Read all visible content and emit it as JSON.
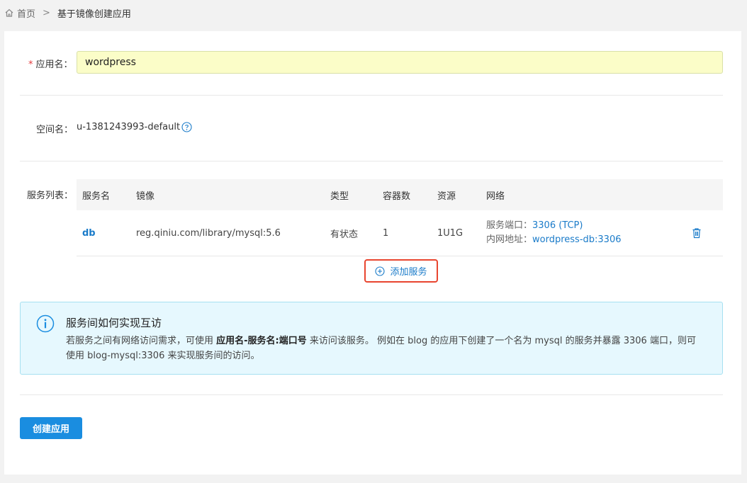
{
  "breadcrumb": {
    "home": "首页",
    "separator": ">",
    "current": "基于镜像创建应用"
  },
  "form": {
    "required_mark": "*",
    "app_name_label": "应用名：",
    "app_name_value": "wordpress",
    "namespace_label": "空间名：",
    "namespace_value": "u-1381243993-default",
    "services_label": "服务列表："
  },
  "table": {
    "headers": [
      "服务名",
      "镜像",
      "类型",
      "容器数",
      "资源",
      "网络"
    ],
    "rows": [
      {
        "name": "db",
        "image": "reg.qiniu.com/library/mysql:5.6",
        "type": "有状态",
        "containers": "1",
        "resource": "1U1G",
        "port_key": "服务端口：",
        "port_value": "3306 (TCP)",
        "addr_key": "内网地址：",
        "addr_value": "wordpress-db:3306"
      }
    ]
  },
  "add_service_label": "添加服务",
  "info": {
    "title": "服务间如何实现互访",
    "body_1": "若服务之间有网络访问需求，可使用 ",
    "body_bold": "应用名-服务名:端口号",
    "body_2": " 来访问该服务。 例如在 blog 的应用下创建了一个名为 mysql 的服务并暴露 3306 端口，则可使用 blog-mysql:3306 来实现服务间的访问。"
  },
  "create_button_label": "创建应用",
  "colors": {
    "primary": "#1a8de0",
    "link": "#1a7bc9",
    "highlight_border": "#e8452f",
    "input_bg": "#fbfdc8",
    "info_bg": "#e6f8fe"
  }
}
